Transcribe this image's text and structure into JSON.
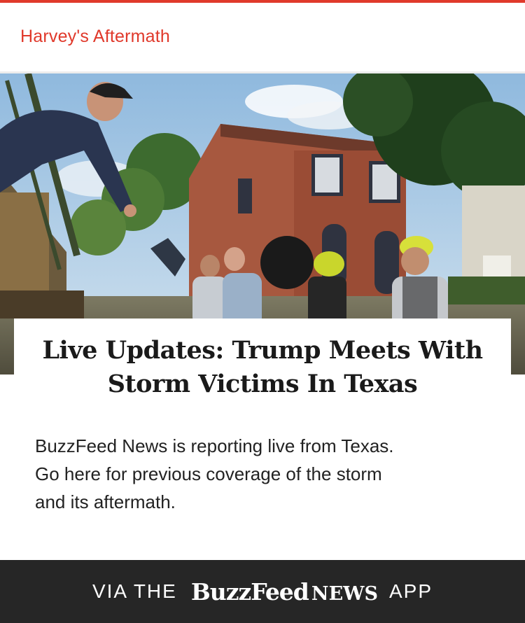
{
  "colors": {
    "accent": "#e0392b",
    "footer_bg": "#262626",
    "text": "#222222"
  },
  "section": {
    "title": "Harvey's Aftermath"
  },
  "hero_image": {
    "subject": "rescue workers with storm victims in front of flooded brick houses"
  },
  "article": {
    "headline_line1": "Live Updates: Trump Meets With",
    "headline_line2": "Storm Victims In Texas",
    "summary_line1": "BuzzFeed News is reporting live from Texas.",
    "summary_line2": "Go here for previous coverage of the storm",
    "summary_line3": "and its aftermath."
  },
  "footer": {
    "prefix": "VIA THE",
    "logo_buzzfeed": "BuzzFeed",
    "logo_news": "NEWS",
    "suffix": "APP"
  }
}
